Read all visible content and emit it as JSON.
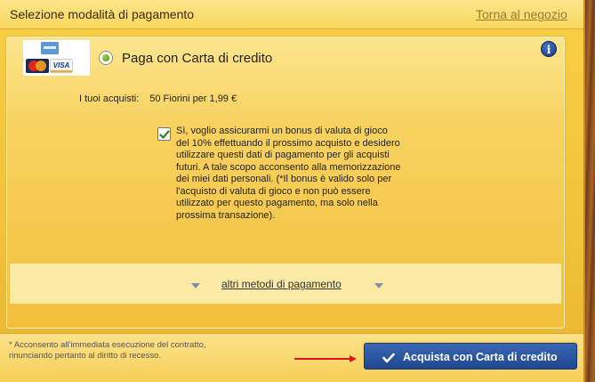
{
  "header": {
    "title": "Selezione modalità di pagamento",
    "back_link": "Torna al negozio"
  },
  "payment": {
    "method_label": "Paga con Carta di credito",
    "purchase_label": "I tuoi acquisti:",
    "purchase_value": "50 Fiorini per 1,99 €",
    "consent_text": "Sì, voglio assicurarmi un bonus di valuta di gioco del 10% effettuando il prossimo acquisto e desidero utilizzare questi dati di pagamento per gli acquisti futuri. A tale scopo acconsento alla memorizzazione dei miei dati personali. (*Il bonus è valido solo per l'acquisto di valuta di gioco e non può essere utilizzato per questo pagamento, ma solo nella prossima transazione).",
    "consent_checked": true,
    "card_logos": [
      "American Express",
      "MasterCard",
      "VISA"
    ],
    "visa_text": "VISA",
    "selected": true
  },
  "alternatives": {
    "link_label": "altri metodi di pagamento"
  },
  "footer": {
    "footnote": "* Acconsento all'immediata esecuzione del contratto, rinunciando pertanto al diritto di recesso.",
    "buy_button_label": "Acquista con Carta di credito"
  },
  "icons": {
    "info": "info-icon",
    "check": "check-icon",
    "arrow": "red-arrow-icon"
  },
  "colors": {
    "accent": "#1f478f",
    "header_bg": "#f8d75e",
    "radio_selected": "#6aa51f"
  }
}
